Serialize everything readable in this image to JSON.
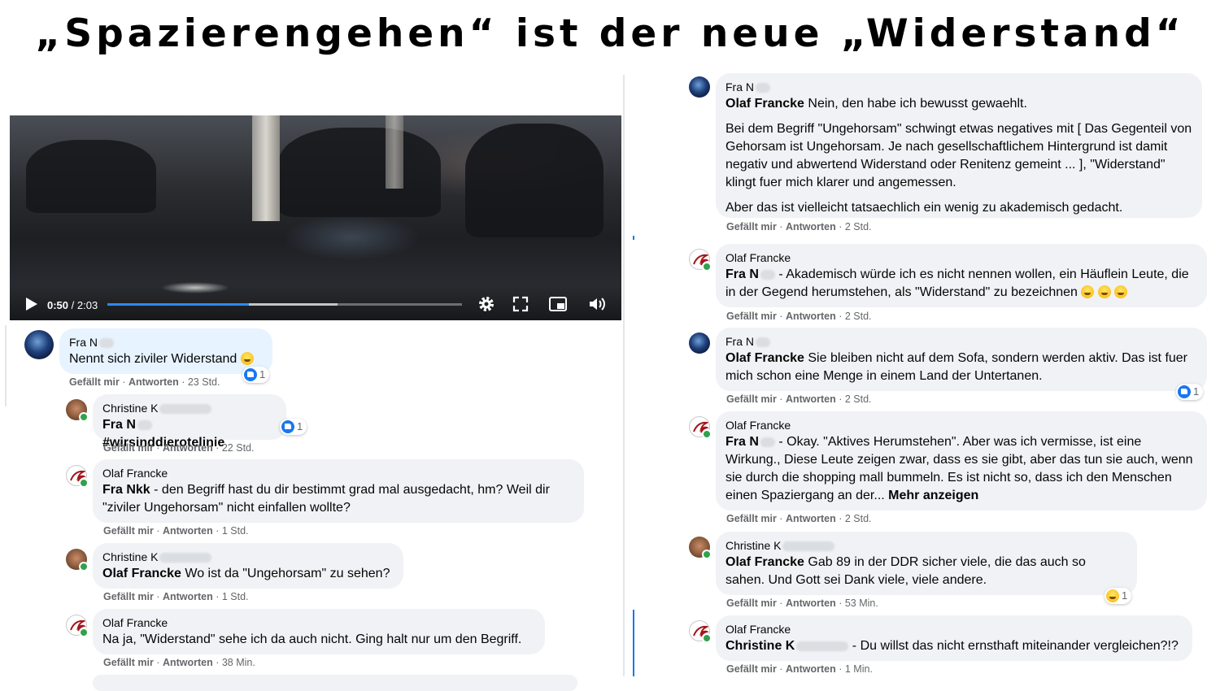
{
  "headline": "„Spazierengehen“ ist der neue „Widerstand“",
  "video": {
    "current": "0:50",
    "duration": "2:03",
    "progress": 0.4,
    "buffered": 0.65
  },
  "left": [
    {
      "author": "Fra N",
      "text": "Nennt sich ziviler Widerstand",
      "reaction": "1",
      "meta": {
        "like": "Gefällt mir",
        "reply": "Antworten",
        "time": "23 Std."
      }
    },
    {
      "author": "Christine K",
      "tag": "Fra N",
      "text": "#wirsinddierotelinie",
      "reaction": "1",
      "meta": {
        "like": "Gefällt mir",
        "reply": "Antworten",
        "time": "22 Std."
      }
    },
    {
      "author": "Olaf Francke",
      "tag": "Fra Nkk",
      "text": " - den Begriff hast du dir bestimmt grad mal ausgedacht, hm? Weil dir \"ziviler Ungehorsam\" nicht einfallen wollte?",
      "meta": {
        "like": "Gefällt mir",
        "reply": "Antworten",
        "time": "1 Std."
      }
    },
    {
      "author": "Christine K",
      "tag": "Olaf Francke",
      "text": " Wo ist da \"Ungehorsam\" zu sehen?",
      "meta": {
        "like": "Gefällt mir",
        "reply": "Antworten",
        "time": "1 Std."
      }
    },
    {
      "author": "Olaf Francke",
      "text": "Na ja, \"Widerstand\" sehe ich da auch nicht. Ging halt nur um den Begriff.",
      "meta": {
        "like": "Gefällt mir",
        "reply": "Antworten",
        "time": "38 Min."
      }
    }
  ],
  "right": [
    {
      "author": "Fra N",
      "tag": "Olaf Francke",
      "text": " Nein, den habe ich bewusst gewaehlt.",
      "para2": "Bei dem Begriff \"Ungehorsam\" schwingt etwas negatives mit [ Das Gegenteil von Gehorsam ist Ungehorsam. Je nach gesellschaftlichem Hintergrund ist damit negativ und abwertend Widerstand oder Renitenz gemeint ... ], \"Widerstand\" klingt fuer mich klarer und angemessen.",
      "para3": "Aber das ist vielleicht tatsaechlich ein wenig zu akademisch gedacht.",
      "meta": {
        "like": "Gefällt mir",
        "reply": "Antworten",
        "time": "2 Std."
      }
    },
    {
      "author": "Olaf Francke",
      "tag": "Fra N",
      "text": " - Akademisch würde ich es nicht nennen wollen, ein Häuflein Leute, die in der Gegend herumstehen, als \"Widerstand\" zu bezeichnen",
      "meta": {
        "like": "Gefällt mir",
        "reply": "Antworten",
        "time": "2 Std."
      }
    },
    {
      "author": "Fra N",
      "tag": "Olaf Francke",
      "text": " Sie bleiben nicht auf dem Sofa, sondern werden aktiv. Das ist fuer mich schon eine Menge in einem Land der Untertanen.",
      "reaction": "1",
      "meta": {
        "like": "Gefällt mir",
        "reply": "Antworten",
        "time": "2 Std."
      }
    },
    {
      "author": "Olaf Francke",
      "tag": "Fra N",
      "text": " - Okay. \"Aktives Herumstehen\". Aber was ich vermisse, ist eine Wirkung., Diese Leute zeigen zwar, dass es sie gibt, aber das tun sie auch, wenn sie durch die shopping mall bummeln. Es ist nicht so, dass ich den Menschen einen Spaziergang an der...",
      "more": "Mehr anzeigen",
      "meta": {
        "like": "Gefällt mir",
        "reply": "Antworten",
        "time": "2 Std."
      }
    },
    {
      "author": "Christine K",
      "tag": "Olaf Francke",
      "text": " Gab 89 in der DDR sicher viele, die das auch so sahen. Und Gott sei Dank viele, viele andere.",
      "reaction": "1",
      "meta": {
        "like": "Gefällt mir",
        "reply": "Antworten",
        "time": "53 Min."
      }
    },
    {
      "author": "Olaf Francke",
      "tag": "Christine K",
      "text": " - Du willst das nicht ernsthaft miteinander vergleichen?!?",
      "meta": {
        "like": "Gefällt mir",
        "reply": "Antworten",
        "time": "1 Min."
      }
    }
  ]
}
